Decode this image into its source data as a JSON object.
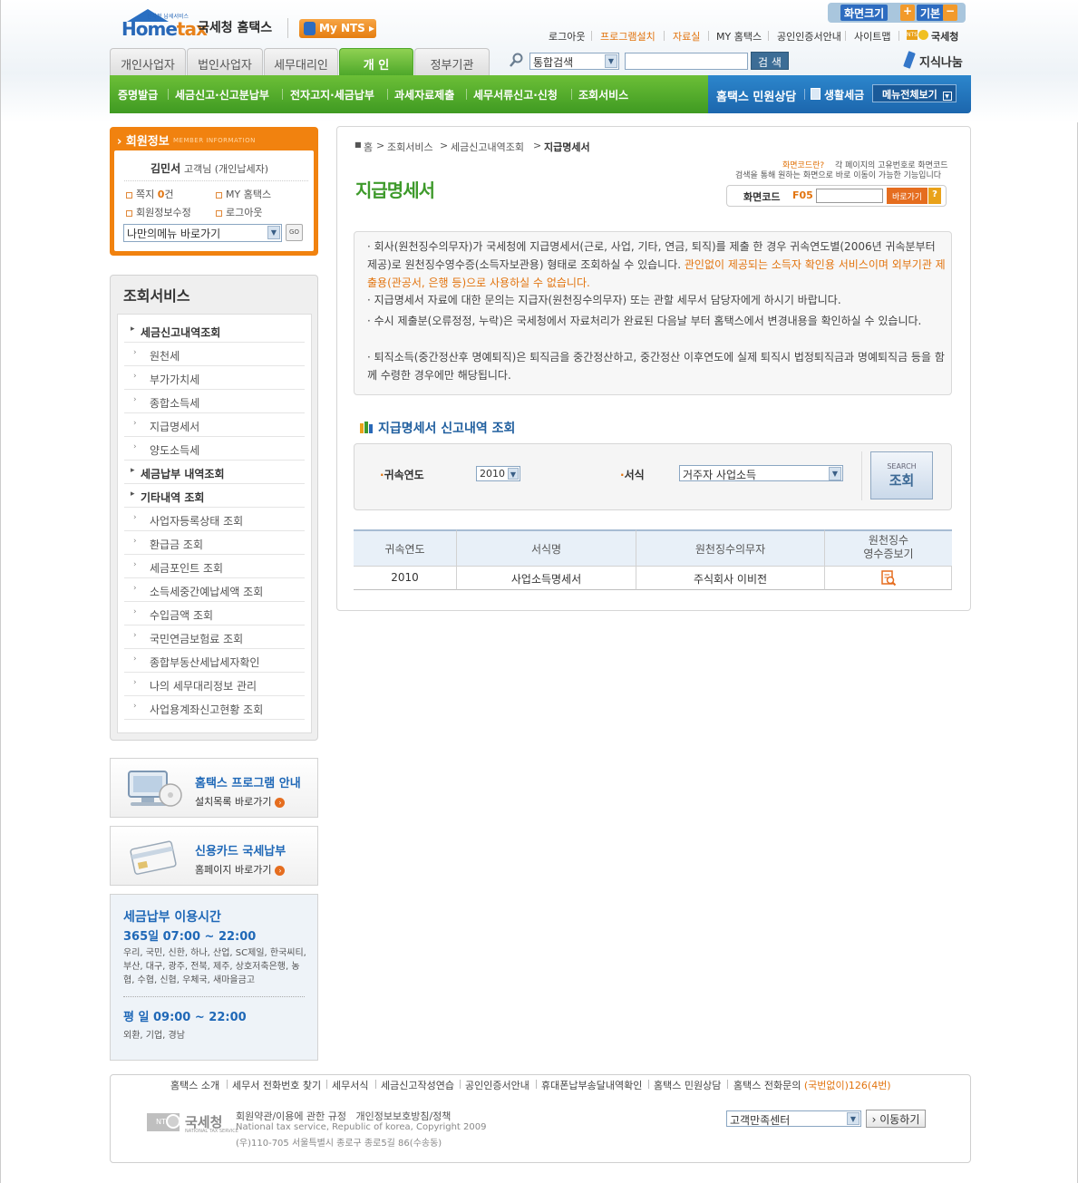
{
  "header": {
    "logo_text": "Hometax",
    "logo_small": "전자적 납세서비스",
    "brand": "국세청 홈택스",
    "mynts": "My NTS",
    "size_label": "화면크기",
    "size_plus": "+",
    "size_default": "기본",
    "size_minus": "−",
    "toplinks": [
      "로그아웃",
      "프로그램설치",
      "자료실",
      "MY 홈택스",
      "공인인증서안내",
      "사이트맵"
    ],
    "nts_label": "국세청",
    "nts_small": "NTS"
  },
  "nav": {
    "tabs": [
      "개인사업자",
      "법인사업자",
      "세무대리인",
      "개 인",
      "정부기관"
    ],
    "search_scope": "통합검색",
    "search_value": "",
    "search_button": "검 색",
    "jisik": "지식나눔",
    "gnb": [
      "증명발급",
      "세금신고·신고분납부",
      "전자고지·세금납부",
      "과세자료제출",
      "세무서류신고·신청",
      "조회서비스"
    ],
    "gnb_right": [
      "홈택스 민원상담",
      "생활세금"
    ],
    "allmenu": "메뉴전체보기"
  },
  "member": {
    "title": "회원정보",
    "subtitle": "MEMBER INFORMATION",
    "name": "김민서",
    "suffix": "고객님 (개인납세자)",
    "note_label": "쪽지",
    "note_count": "0",
    "note_unit": "건",
    "links": [
      "MY 홈택스",
      "회원정보수정",
      "로그아웃"
    ],
    "quick_select": "나만의메뉴 바로가기",
    "go": "GO"
  },
  "side": {
    "title": "조회서비스",
    "items": [
      {
        "label": "세금신고내역조회",
        "main": true
      },
      {
        "label": "원천세",
        "main": false
      },
      {
        "label": "부가가치세",
        "main": false
      },
      {
        "label": "종합소득세",
        "main": false
      },
      {
        "label": "지급명세서",
        "main": false
      },
      {
        "label": "양도소득세",
        "main": false
      },
      {
        "label": "세금납부 내역조회",
        "main": true
      },
      {
        "label": "기타내역 조회",
        "main": true
      },
      {
        "label": "사업자등록상태 조회",
        "main": false
      },
      {
        "label": "환급금 조회",
        "main": false
      },
      {
        "label": "세금포인트 조회",
        "main": false
      },
      {
        "label": "소득세중간예납세액 조회",
        "main": false
      },
      {
        "label": "수입금액 조회",
        "main": false
      },
      {
        "label": "국민연금보험료 조회",
        "main": false
      },
      {
        "label": "종합부동산세납세자확인",
        "main": false
      },
      {
        "label": "나의 세무대리정보 관리",
        "main": false
      },
      {
        "label": "사업용계좌신고현황 조회",
        "main": false
      }
    ]
  },
  "banners": {
    "program_title": "홈택스 프로그램 안내",
    "program_sub": "설치목록 바로가기",
    "card_title": "신용카드 국세납부",
    "card_sub": "홈페이지 바로가기",
    "time_title": "세금납부 이용시간",
    "time_365": "365일 07:00 ~ 22:00",
    "time_banks": "우리, 국민, 신한, 하나, 산업, SC제일, 한국씨티, 부산, 대구, 광주, 전북, 제주, 상호저축은행, 농협, 수협, 신협, 우체국, 새마을금고",
    "time_weekday": "평 일 09:00 ~ 22:00",
    "time_weekday_banks": "외환, 기업, 경남"
  },
  "main": {
    "crumbs": [
      "홈",
      "조회서비스",
      "세금신고내역조회",
      "지급명세서"
    ],
    "title": "지급명세서",
    "hint_label": "화면코드란?",
    "hint_text1": "각 페이지의 고유번호로 화면코드",
    "hint_text2": "검색을 통해 원하는 화면으로 바로 이동이 가능한 기능입니다",
    "code_label": "화면코드",
    "code_prefix": "F05",
    "code_value": "",
    "code_button": "바로가기",
    "code_help": "?",
    "info": [
      {
        "a": "회사(원천징수의무자)가 국세청에 지급명세서(근로, 사업, 기타, 연금, 퇴직)를 제출 한 경우 귀속연도별(2006년 귀속분부터 제공)로 원천징수영수증(소득자보관용) 형태로 조회하실 수 있습니다. ",
        "b": "관인없이 제공되는 소득자 확인용 서비스이며 외부기관 제출용(관공서, 은행 등)으로 사용하실 수 없습니다."
      },
      {
        "a": "지급명세서 자료에 대한 문의는 지급자(원천징수의무자) 또는 관할 세무서 담당자에게 하시기 바랍니다.",
        "b": ""
      },
      {
        "a": "수시 제출분(오류정정, 누락)은 국세청에서 자료처리가 완료된 다음날 부터 홈택스에서 변경내용을 확인하실 수 있습니다.",
        "b": ""
      },
      {
        "a": "퇴직소득(중간정산후 명예퇴직)은 퇴직금을 중간정산하고, 중간정산 이후연도에 실제 퇴직시 법정퇴직금과 명예퇴직금 등을 함께 수령한 경우에만 해당됩니다.",
        "b": ""
      }
    ],
    "section_title": "지급명세서 신고내역 조회",
    "year_label": "귀속연도",
    "year_value": "2010",
    "form_label": "서식",
    "form_value": "거주자 사업소득",
    "search_en": "SEARCH",
    "search_ko": "조회",
    "table": {
      "headers": [
        "귀속연도",
        "서식명",
        "원천징수의무자",
        "원천징수\n영수증보기"
      ],
      "rows": [
        {
          "year": "2010",
          "form": "사업소득명세서",
          "payer": "주식회사 이비전"
        }
      ]
    }
  },
  "footer": {
    "links": [
      "홈택스 소개",
      "세무서 전화번호 찾기",
      "세무서식",
      "세금신고작성연습",
      "공인인증서안내",
      "휴대폰납부송달내역확인",
      "홈택스 민원상담"
    ],
    "phone_label": "홈택스 전화문의",
    "phone_value": "(국번없이)126(4번)",
    "logo": "국세청",
    "logo_sub": "NATIONAL TAX SERVICE",
    "policy": "회원약관/이용에 관한 규정   개인정보보호방침/정책",
    "copyright": "National tax service, Republic of korea, Copyright 2009",
    "address": "(우)110-705 서울특별시 종로구 종로5길 86(수송동)",
    "select": "고객만족센터",
    "go": "이동하기"
  },
  "colors": {
    "green": "#3e9a2b",
    "orange": "#f1820f",
    "blue": "#1f68b7"
  }
}
